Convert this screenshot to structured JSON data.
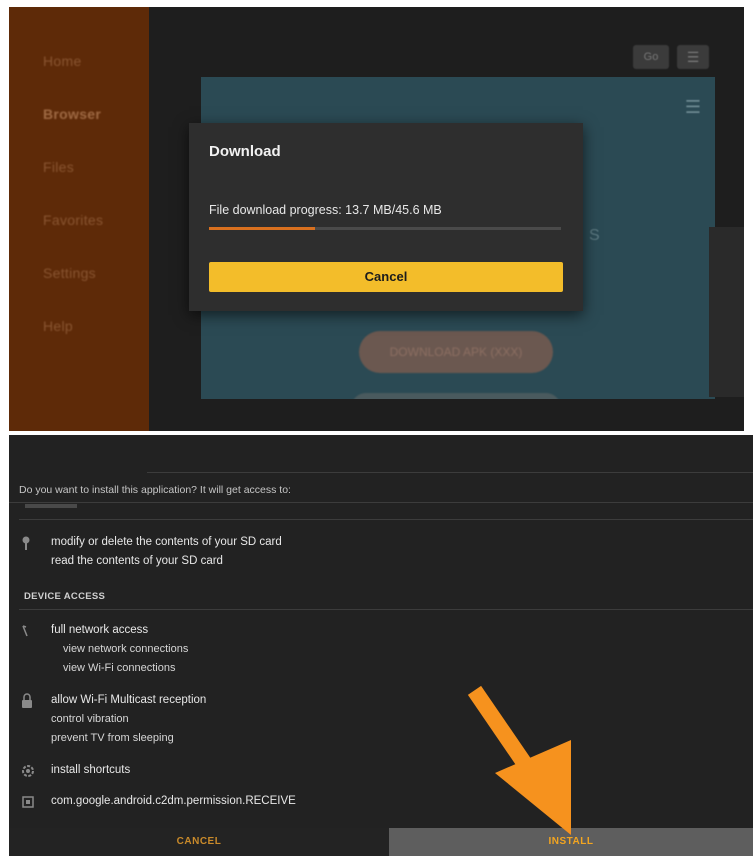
{
  "sidebar": {
    "items": [
      {
        "label": "Home"
      },
      {
        "label": "Browser"
      },
      {
        "label": "Files"
      },
      {
        "label": "Favorites"
      },
      {
        "label": "Settings"
      },
      {
        "label": "Help"
      }
    ],
    "active": "Browser"
  },
  "toolbar": {
    "go_label": "Go",
    "menu_icon": "menu-icon"
  },
  "webpage": {
    "download_button_label": "DOWNLOAD APK (XXX)",
    "partial_text": "S"
  },
  "download_dialog": {
    "title": "Download",
    "progress_text": "File download progress: 13.7 MB/45.6 MB",
    "progress_fraction": 0.3,
    "cancel_label": "Cancel"
  },
  "install": {
    "question": "Do you want to install this application? It will get access to:",
    "storage_permissions": [
      "modify or delete the contents of your SD card",
      "read the contents of your SD card"
    ],
    "device_access_heading": "DEVICE ACCESS",
    "network_permissions": [
      "full network access",
      "view network connections",
      "view Wi-Fi connections"
    ],
    "system_permissions": [
      "allow Wi-Fi Multicast reception",
      "control vibration",
      "prevent TV from sleeping"
    ],
    "shortcut_permission": "install shortcuts",
    "c2dm_permission": "com.google.android.c2dm.permission.RECEIVE",
    "cancel_label": "CANCEL",
    "install_label": "INSTALL"
  },
  "colors": {
    "sidebar_bg": "#5e2a08",
    "accent_yellow": "#f3bd2a",
    "progress_orange": "#d8701f",
    "arrow_orange": "#f6921e",
    "install_text": "#f3a520"
  }
}
